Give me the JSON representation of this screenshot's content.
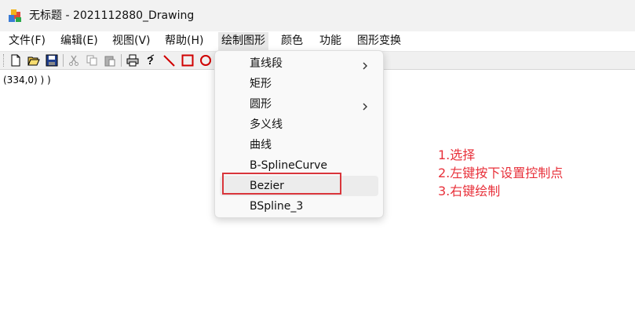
{
  "window": {
    "title": "无标题 - 2021112880_Drawing",
    "icon": "app-icon"
  },
  "menubar": {
    "items": [
      {
        "label": "文件(F)"
      },
      {
        "label": "编辑(E)"
      },
      {
        "label": "视图(V)"
      },
      {
        "label": "帮助(H)"
      },
      {
        "label": "绘制图形"
      },
      {
        "label": "颜色"
      },
      {
        "label": "功能"
      },
      {
        "label": "图形变换"
      }
    ],
    "open_menu": "绘制图形"
  },
  "toolbar": {
    "buttons": [
      "new-file-icon",
      "open-folder-icon",
      "save-icon",
      "cut-icon",
      "copy-icon",
      "paste-icon",
      "print-icon",
      "help-icon",
      "line-tool-icon",
      "rectangle-tool-icon",
      "circle-tool-icon"
    ]
  },
  "canvas": {
    "status_text": "(334,0) ) )"
  },
  "dropdown": {
    "items": [
      {
        "label": "直线段",
        "submenu": true
      },
      {
        "label": "矩形",
        "submenu": false
      },
      {
        "label": "圆形",
        "submenu": true
      },
      {
        "label": "多义线",
        "submenu": false
      },
      {
        "label": "曲线",
        "submenu": false
      },
      {
        "label": "B-SplineCurve",
        "submenu": false
      },
      {
        "label": "Bezier",
        "submenu": false,
        "highlighted": true
      },
      {
        "label": "BSpline_3",
        "submenu": false
      }
    ]
  },
  "annotation": {
    "lines": [
      "1.选择",
      "2.左键按下设置控制点",
      "3.右键绘制"
    ],
    "color": "#e8303a"
  },
  "colors": {
    "highlight_box": "#d9353b",
    "line_tool": "#d00000",
    "rect_tool": "#d00000",
    "circle_tool": "#d00000"
  }
}
